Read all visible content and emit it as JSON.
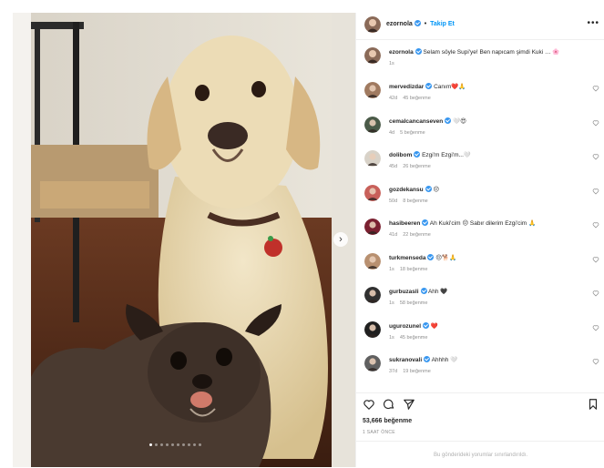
{
  "post": {
    "author": "ezornola",
    "follow_label": "Takip Et",
    "caption": "Selam söyle Supi'ye! Ben napıcam şimdi Kuki … 🌸",
    "caption_time": "1s",
    "likes": "53,666 beğenme",
    "date": "1 SAAT ÖNCE",
    "comments_limited": "Bu gönderideki yorumlar sınırlandırıldı.",
    "carousel": {
      "count": 10,
      "active": 0
    }
  },
  "comments": [
    {
      "user": "mervedizdar",
      "text": "Canım❤️🙏",
      "time": "42d",
      "likes": "45 beğenme",
      "avatar_color": "#a07a60"
    },
    {
      "user": "cemalcancanseven",
      "text": "🤍😍",
      "time": "4d",
      "likes": "5 beğenme",
      "avatar_color": "#4a5a48"
    },
    {
      "user": "dolibom",
      "text": "Ezgi'm Ezgi'm...🤍",
      "time": "45d",
      "likes": "26 beğenme",
      "avatar_color": "#d8d2c8"
    },
    {
      "user": "gozdekansu",
      "text": "😔",
      "time": "50d",
      "likes": "8 beğenme",
      "avatar_color": "#c8605a"
    },
    {
      "user": "hasibeeren",
      "text": "Ah Kuki'cim 😔 Sabır dilerim Ezgi'cim 🙏",
      "time": "41d",
      "likes": "22 beğenme",
      "avatar_color": "#7a2030"
    },
    {
      "user": "turkmenseda",
      "text": "😔🐕🙏",
      "time": "1s",
      "likes": "18 beğenme",
      "avatar_color": "#b89070"
    },
    {
      "user": "gurbuzasli",
      "text": "Ahh 🖤",
      "time": "1s",
      "likes": "58 beğenme",
      "avatar_color": "#303030"
    },
    {
      "user": "ugurozunel",
      "text": "❤️",
      "time": "1s",
      "likes": "45 beğenme",
      "avatar_color": "#202020"
    },
    {
      "user": "sukranovali",
      "text": "Ahhhh 🤍",
      "time": "37d",
      "likes": "19 beğenme",
      "avatar_color": "#606060"
    }
  ],
  "colors": {
    "link": "#0095f6",
    "verified": "#3897f0",
    "meta": "#8e8e8e",
    "text": "#262626"
  },
  "icons": {
    "like": "heart-icon",
    "comment": "comment-icon",
    "share": "share-icon",
    "save": "bookmark-icon",
    "more": "more-icon",
    "next": "chevron-right-icon"
  }
}
